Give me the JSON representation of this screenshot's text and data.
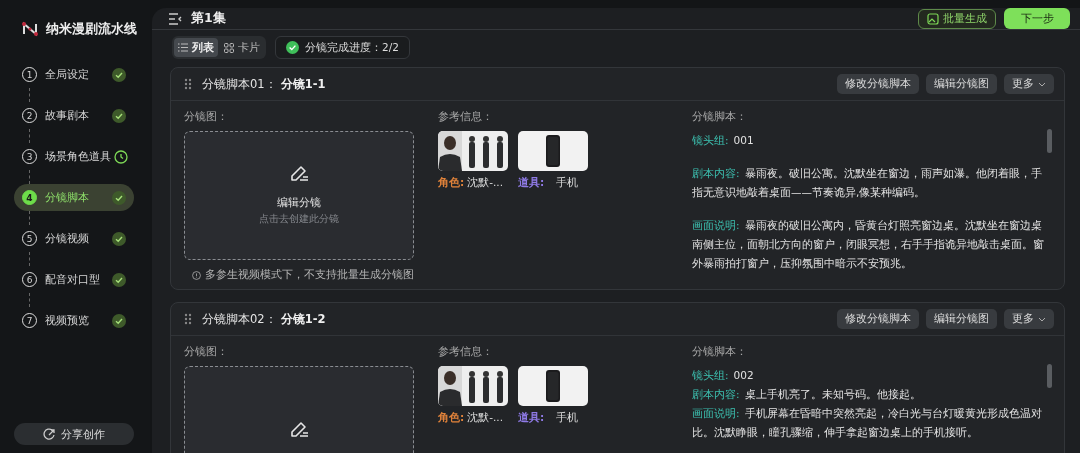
{
  "app": {
    "title": "纳米漫剧流水线"
  },
  "steps": [
    {
      "number": "1",
      "label": "全局设定",
      "kind": "done",
      "selected": false
    },
    {
      "number": "2",
      "label": "故事剧本",
      "kind": "done",
      "selected": false
    },
    {
      "number": "3",
      "label": "场景角色道具",
      "kind": "pending",
      "selected": false
    },
    {
      "number": "4",
      "label": "分镜脚本",
      "kind": "done",
      "selected": true
    },
    {
      "number": "5",
      "label": "分镜视频",
      "kind": "done",
      "selected": false
    },
    {
      "number": "6",
      "label": "配音对口型",
      "kind": "done",
      "selected": false
    },
    {
      "number": "7",
      "label": "视频预览",
      "kind": "done",
      "selected": false
    }
  ],
  "share_button": "分享创作",
  "header": {
    "title": "第1集",
    "batch_button": "批量生成",
    "next_button": "下一步"
  },
  "view_tabs": [
    {
      "label": "列表",
      "kind": "list",
      "selected": true
    },
    {
      "label": "卡片",
      "kind": "grid",
      "selected": false
    }
  ],
  "progress": {
    "text": "分镜完成进度：2/2"
  },
  "cards": [
    {
      "prefix": "分镜脚本01：",
      "name": "分镜1-1",
      "actions": [
        "修改分镜脚本",
        "编辑分镜图"
      ],
      "more": "更多",
      "kind": "spaced",
      "storyboard": {
        "label": "分镜图：",
        "title": "编辑分镜",
        "hint": "点击去创建此分镜",
        "note": "多参生视频模式下，不支持批量生成分镜图"
      },
      "refs_label": "参考信息：",
      "refs": [
        {
          "tag": "角色:",
          "color": "#e0823a",
          "name": "沈默-...",
          "kind": "figures"
        },
        {
          "tag": "道具:",
          "color": "#8f7ae6",
          "name": "手机",
          "kind": "phone"
        }
      ],
      "script_label": "分镜脚本：",
      "script": [
        {
          "key": "镜头组:",
          "text": "001"
        },
        {
          "key": "剧本内容:",
          "text": "暴雨夜。破旧公寓。沈默坐在窗边，雨声如瀑。他闭着眼，手指无意识地敲着桌面——节奏诡异,像某种编码。"
        },
        {
          "key": "画面说明:",
          "text": "暴雨夜的破旧公寓内，昏黄台灯照亮窗边桌。沈默坐在窗边桌南侧主位，面朝北方向的窗户，闭眼冥想，右手手指诡异地敲击桌面。窗外暴雨拍打窗户，压抑氛围中暗示不安预兆。"
        }
      ]
    },
    {
      "prefix": "分镜脚本02：",
      "name": "分镜1-2",
      "actions": [
        "修改分镜脚本",
        "编辑分镜图"
      ],
      "more": "更多",
      "kind": "compact",
      "storyboard": {
        "label": "分镜图："
      },
      "refs_label": "参考信息：",
      "refs": [
        {
          "tag": "角色:",
          "color": "#e0823a",
          "name": "沈默-...",
          "kind": "figures"
        },
        {
          "tag": "道具:",
          "color": "#8f7ae6",
          "name": "手机",
          "kind": "phone"
        }
      ],
      "script_label": "分镜脚本：",
      "script": [
        {
          "key": "镜头组:",
          "text": "002"
        },
        {
          "key": "剧本内容:",
          "text": "桌上手机亮了。未知号码。他接起。"
        },
        {
          "key": "画面说明:",
          "text": "手机屏幕在昏暗中突然亮起，冷白光与台灯暖黄光形成色温对比。沈默睁眼，瞳孔骤缩，伸手拿起窗边桌上的手机接听。"
        }
      ]
    }
  ]
}
